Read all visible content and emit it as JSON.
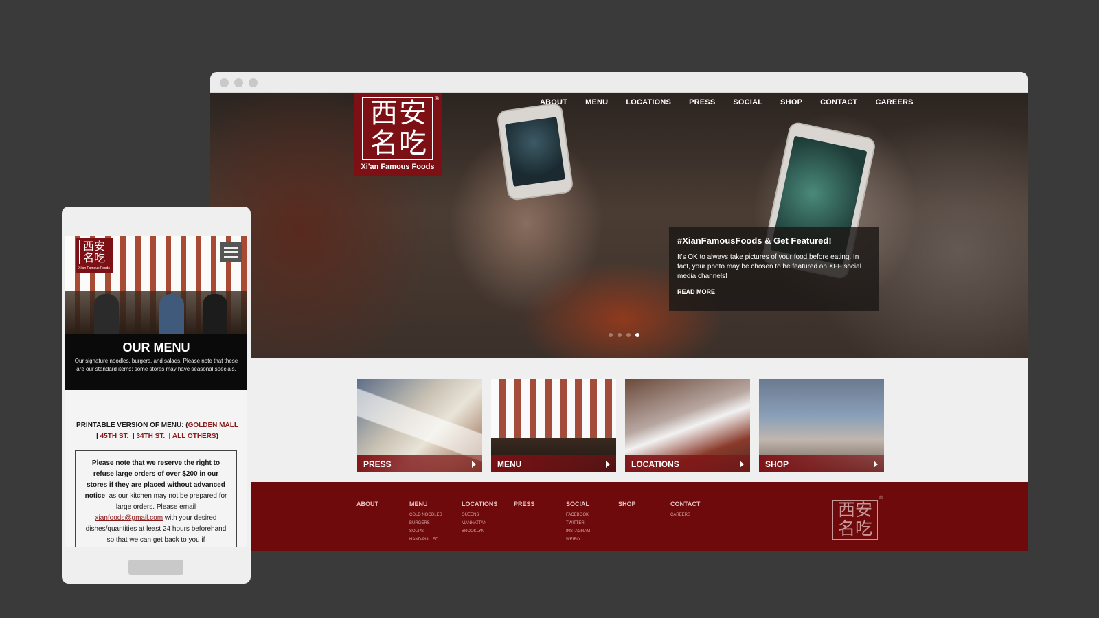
{
  "desktop": {
    "logo": {
      "chars": "西安名吃",
      "reg": "®",
      "text": "Xi'an Famous Foods"
    },
    "nav": [
      "ABOUT",
      "MENU",
      "LOCATIONS",
      "PRESS",
      "SOCIAL",
      "SHOP",
      "CONTACT",
      "CAREERS"
    ],
    "promo": {
      "title": "#XianFamousFoods & Get Featured!",
      "body": "It's OK to always take pictures of your food before eating. In fact, your photo may be chosen to be featured on XFF social media channels!",
      "read_more": "READ MORE"
    },
    "pager": {
      "count": 4,
      "active": 3
    },
    "tiles": [
      {
        "label": "PRESS",
        "icon": "play-arrow-icon"
      },
      {
        "label": "MENU",
        "icon": "play-arrow-icon"
      },
      {
        "label": "LOCATIONS",
        "icon": "play-arrow-icon"
      },
      {
        "label": "SHOP",
        "icon": "play-arrow-icon"
      }
    ],
    "footer": {
      "columns": [
        {
          "heading": "ABOUT",
          "items": []
        },
        {
          "heading": "MENU",
          "items": [
            "COLD NOODLES",
            "BURGERS",
            "SOUPS",
            "HAND-PULLED"
          ]
        },
        {
          "heading": "LOCATIONS",
          "items": [
            "QUEENS",
            "MANHATTAN",
            "BROOKLYN"
          ]
        },
        {
          "heading": "PRESS",
          "items": []
        },
        {
          "heading": "SOCIAL",
          "items": [
            "FACEBOOK",
            "TWITTER",
            "INSTAGRAM",
            "WEIBO"
          ]
        },
        {
          "heading": "SHOP",
          "items": []
        },
        {
          "heading": "CONTACT",
          "items": [
            "CAREERS"
          ]
        }
      ],
      "logo_chars": "西安名吃",
      "logo_reg": "®"
    }
  },
  "mobile": {
    "logo": {
      "chars": "西安名吃",
      "text": "Xi'an Famous Foods"
    },
    "menu_icon": "hamburger-menu-icon",
    "title": "OUR MENU",
    "subtitle": "Our signature noodles, burgers, and salads. Please note that these are our standard items; some stores may have seasonal specials.",
    "printable": {
      "label": "PRINTABLE VERSION OF MENU: (",
      "links": [
        "GOLDEN MALL",
        "45TH ST.",
        "34TH ST.",
        "ALL OTHERS"
      ],
      "close": ")"
    },
    "note": {
      "bold": "Please note that we reserve the right to refuse large orders of over $200 in our stores if they are placed without advanced notice",
      "rest1": ", as our kitchen may not be prepared for large orders. Please email ",
      "email": "xianfoods@gmail.com",
      "rest2": " with your desired dishes/quantities at least 24 hours beforehand so that we can get back to you if"
    }
  }
}
